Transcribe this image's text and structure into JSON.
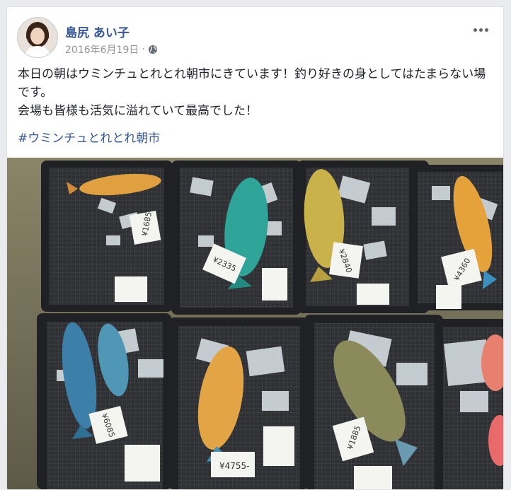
{
  "post": {
    "author": "島尻 あい子",
    "date": "2016年6月19日",
    "separator": "·",
    "line1": "本日の朝はウミンチュとれとれ朝市にきています！釣り好きの身としてはたまらない場です。",
    "line2": "会場も皆様も活気に溢れていて最高でした！",
    "hashtag": "#ウミンチュとれとれ朝市"
  },
  "photo": {
    "price_tags": [
      "¥1685",
      "¥2335",
      "¥2840",
      "¥4360",
      "¥6085",
      "¥4755-",
      "¥1885"
    ],
    "tray_count": 8
  },
  "colors": {
    "link": "#365899",
    "text": "#1d2129",
    "muted": "#90949c"
  },
  "icons": [
    "more-options-icon",
    "globe-icon"
  ]
}
